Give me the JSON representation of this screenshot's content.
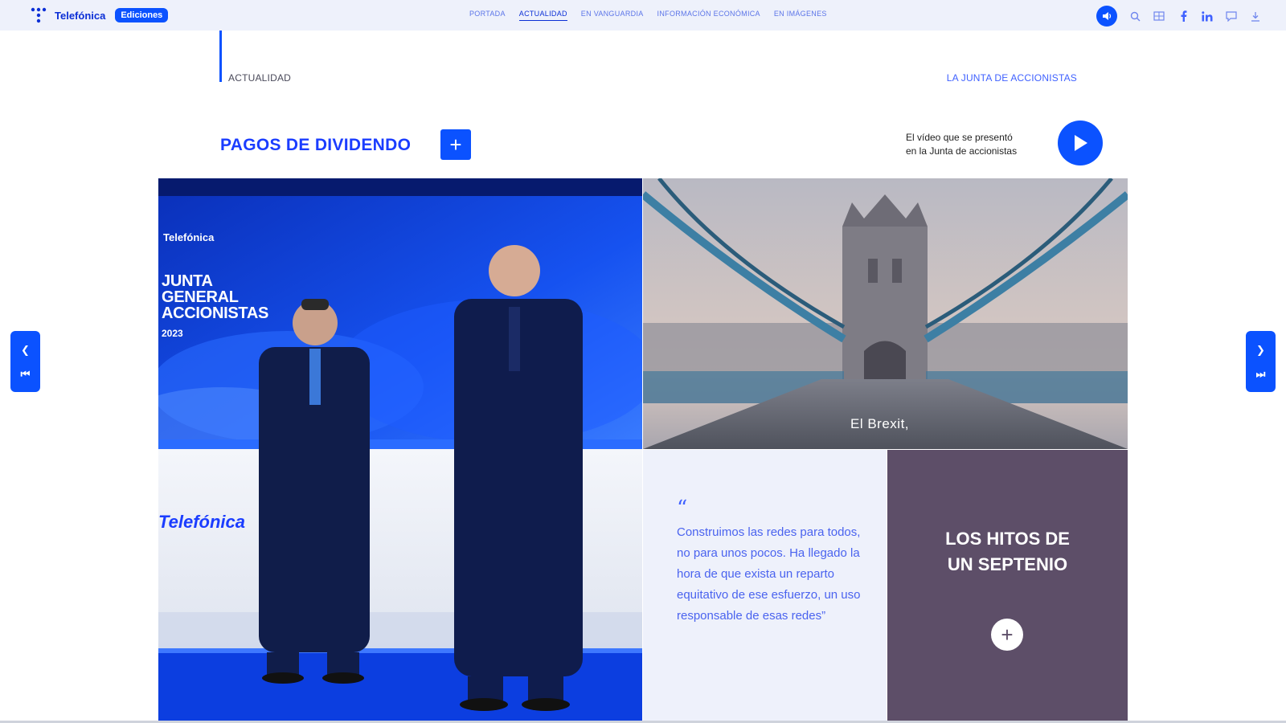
{
  "topbar": {
    "brand_name": "Telefónica",
    "ediciones_label": "Ediciones",
    "nav": [
      {
        "label": "Portada",
        "active": false
      },
      {
        "label": "Actualidad",
        "active": true
      },
      {
        "label": "En vanguardia",
        "active": false
      },
      {
        "label": "Información económica",
        "active": false
      },
      {
        "label": "En imágenes",
        "active": false
      }
    ],
    "icons": [
      "audio-icon",
      "search-icon",
      "menu-grid-icon",
      "facebook-icon",
      "linkedin-icon",
      "chat-icon",
      "download-icon"
    ]
  },
  "header": {
    "section_label": "ACTUALIDAD",
    "junta_link": "LA JUNTA DE ACCIONISTAS"
  },
  "pagos": {
    "title": "PAGOS DE DIVIDENDO",
    "plus_label": "+"
  },
  "video": {
    "line1": "El vídeo que se presentó",
    "line2": "en la Junta de accionistas"
  },
  "photo_main": {
    "screen_brand": "Telefónica",
    "screen_line1": "JUNTA",
    "screen_line2": "GENERAL",
    "screen_line3": "ACCIONISTAS",
    "screen_year": "2023",
    "podium_brand": "Telefónica"
  },
  "bridge": {
    "caption": "El Brexit,"
  },
  "quote": {
    "mark": "“",
    "text": "Construimos las redes para todos, no para unos pocos. Ha llegado la hora de que exista un reparto equitativo de ese esfuerzo, un uso responsable de esas redes”"
  },
  "hitos": {
    "line1": "LOS HITOS DE",
    "line2": "UN SEPTENIO",
    "plus_label": "+"
  },
  "colors": {
    "accent": "#0b52ff",
    "nav_bg": "#eef1fb",
    "hitos_bg": "#5d4e68"
  }
}
